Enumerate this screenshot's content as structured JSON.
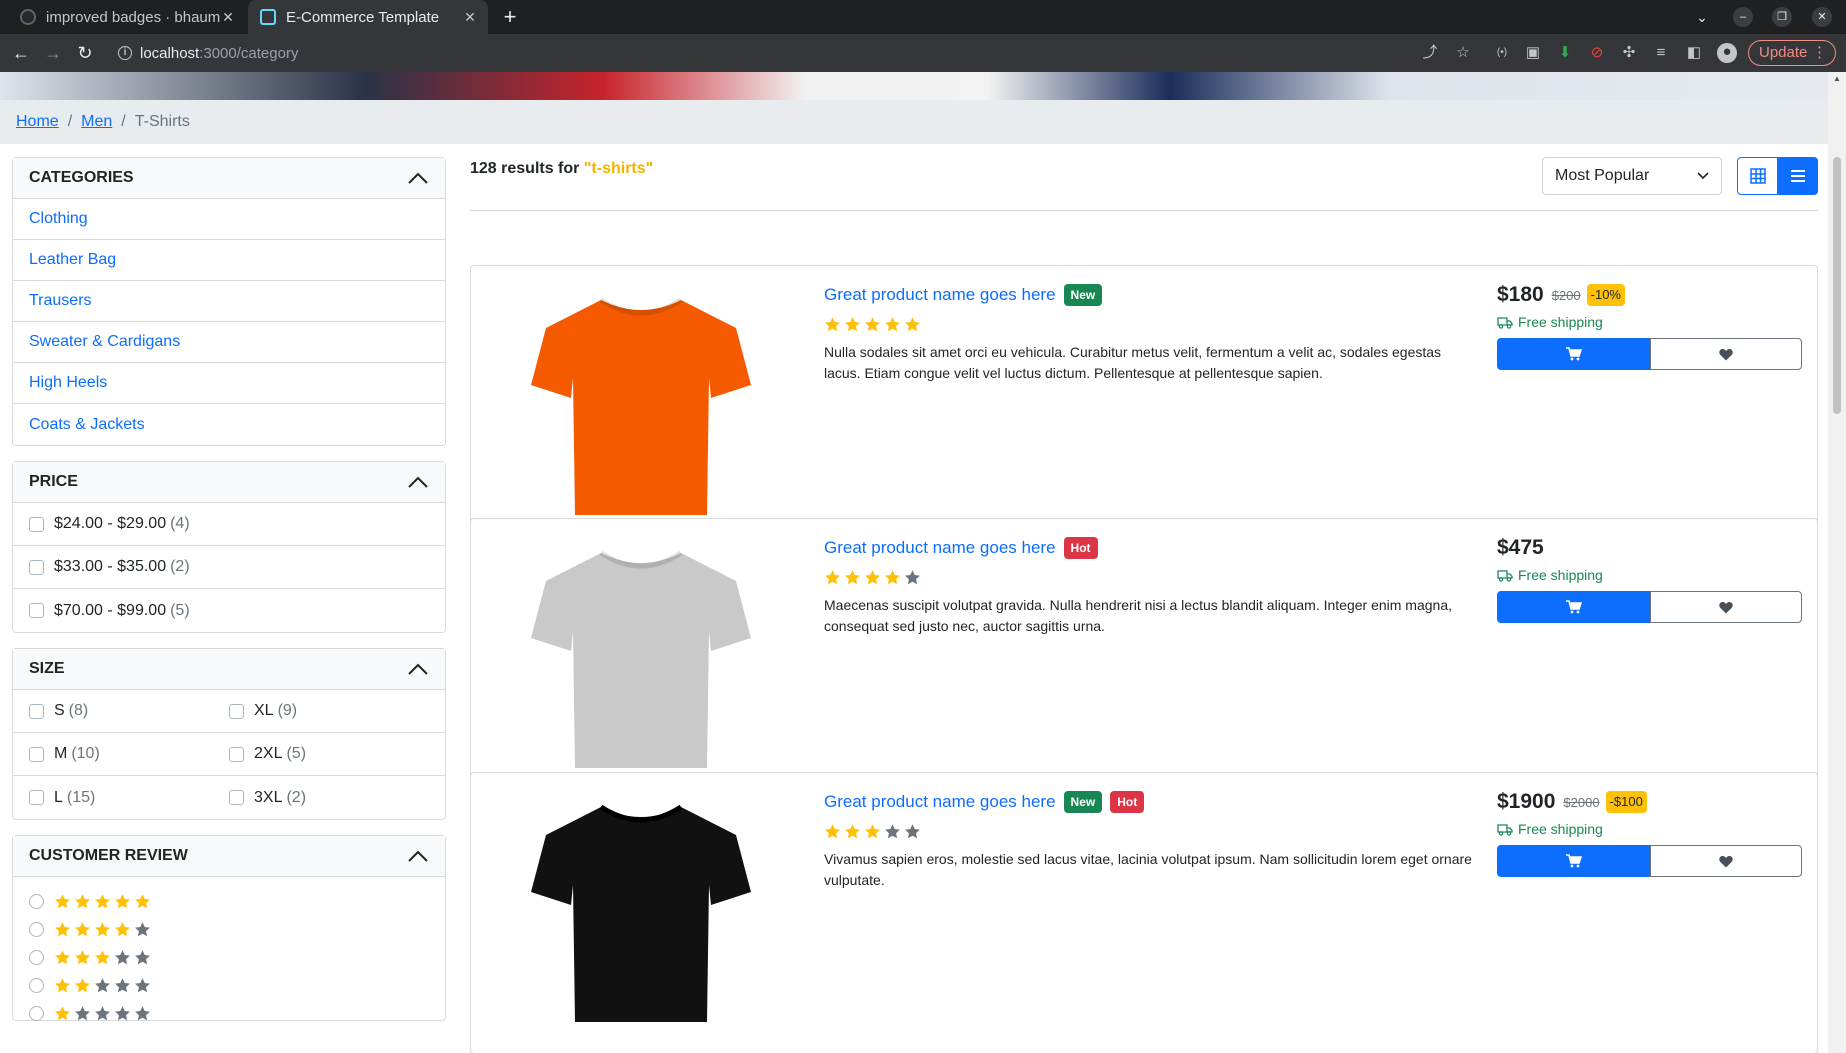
{
  "browser": {
    "tabs": [
      {
        "title": "improved badges · bhaum",
        "active": false
      },
      {
        "title": "E-Commerce Template",
        "active": true
      }
    ],
    "url_host": "localhost",
    "url_path": ":3000/category",
    "update_label": "Update"
  },
  "breadcrumb": {
    "home": "Home",
    "men": "Men",
    "current": "T-Shirts",
    "separator": "/"
  },
  "sidebar": {
    "categories": {
      "title": "CATEGORIES",
      "items": [
        "Clothing",
        "Leather Bag",
        "Trausers",
        "Sweater & Cardigans",
        "High Heels",
        "Coats & Jackets"
      ]
    },
    "price": {
      "title": "PRICE",
      "items": [
        {
          "label": "$24.00 - $29.00",
          "count": "(4)"
        },
        {
          "label": "$33.00 - $35.00",
          "count": "(2)"
        },
        {
          "label": "$70.00 - $99.00",
          "count": "(5)"
        }
      ]
    },
    "size": {
      "title": "SIZE",
      "items": [
        {
          "label": "S",
          "count": "(8)"
        },
        {
          "label": "XL",
          "count": "(9)"
        },
        {
          "label": "M",
          "count": "(10)"
        },
        {
          "label": "2XL",
          "count": "(5)"
        },
        {
          "label": "L",
          "count": "(15)"
        },
        {
          "label": "3XL",
          "count": "(2)"
        }
      ]
    },
    "review": {
      "title": "CUSTOMER REVIEW",
      "options": [
        5,
        4,
        3,
        2,
        1
      ]
    }
  },
  "results": {
    "count_text": "128 results for",
    "query": "\"t-shirts\""
  },
  "sort": {
    "selected": "Most Popular"
  },
  "colors": {
    "primary": "#0d6efd",
    "star_filled": "#ffc107",
    "star_empty": "#6c757d",
    "new_badge": "#198754",
    "hot_badge": "#dc3545",
    "discount_badge": "#ffc107",
    "free_shipping": "#198754"
  },
  "products": [
    {
      "name": "Great product name goes here",
      "badges": [
        "New"
      ],
      "rating": 5,
      "description": "Nulla sodales sit amet orci eu vehicula. Curabitur metus velit, fermentum a velit ac, sodales egestas lacus. Etiam congue velit vel luctus dictum. Pellentesque at pellentesque sapien.",
      "price": "$180",
      "old_price": "$200",
      "discount": "-10%",
      "shipping": "Free shipping",
      "image": "orange-tshirt",
      "shirt_color": "#f55a00"
    },
    {
      "name": "Great product name goes here",
      "badges": [
        "Hot"
      ],
      "rating": 4,
      "description": "Maecenas suscipit volutpat gravida. Nulla hendrerit nisi a lectus blandit aliquam. Integer enim magna, consequat sed justo nec, auctor sagittis urna.",
      "price": "$475",
      "old_price": "",
      "discount": "",
      "shipping": "Free shipping",
      "image": "grey-tshirt",
      "shirt_color": "#c9c9c9"
    },
    {
      "name": "Great product name goes here",
      "badges": [
        "New",
        "Hot"
      ],
      "rating": 3,
      "description": "Vivamus sapien eros, molestie sed lacus vitae, lacinia volutpat ipsum. Nam sollicitudin lorem eget ornare vulputate.",
      "price": "$1900",
      "old_price": "$2000",
      "discount": "-$100",
      "shipping": "Free shipping",
      "image": "black-tshirt",
      "shirt_color": "#111111"
    }
  ]
}
